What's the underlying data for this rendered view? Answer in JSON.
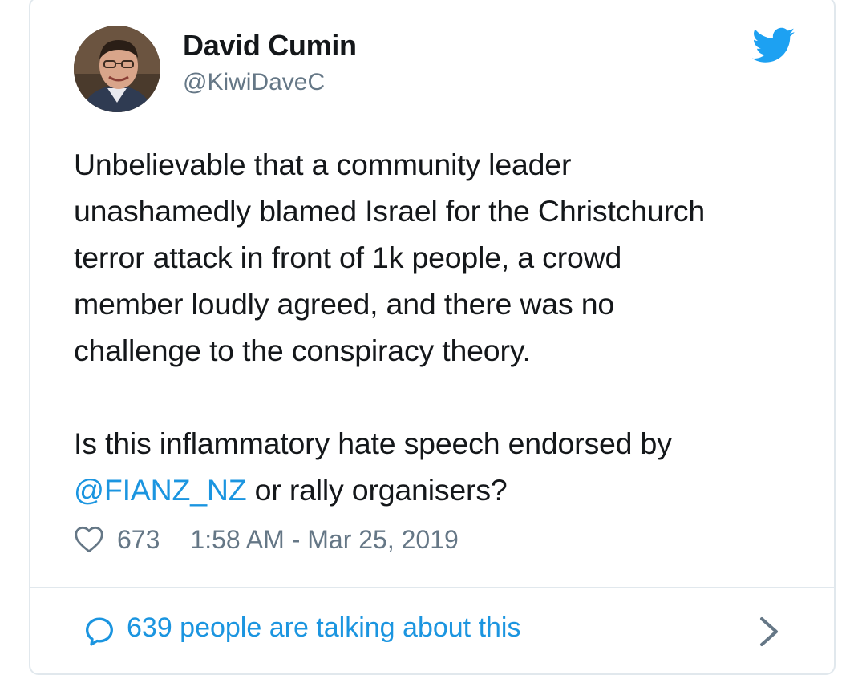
{
  "tweet": {
    "author": {
      "name": "David Cumin",
      "handle": "@KiwiDaveC",
      "avatar_icon": "profile-photo"
    },
    "brand_icon": "twitter-bird-icon",
    "brand_color": "#1da1f2",
    "text": {
      "line1": "Unbelievable that a community leader",
      "line2": "unashamedly blamed Israel for the Christchurch",
      "line3": "terror attack in front of 1k people, a crowd",
      "line4": "member loudly agreed, and there was no",
      "line5": "challenge to the conspiracy theory.",
      "line6": "Is this inflammatory hate speech endorsed by",
      "line7_mention": "@FIANZ_NZ",
      "line7_rest": " or rally organisers?"
    },
    "mention_color": "#1b95e0",
    "likes": "673",
    "timestamp": "1:58 AM - Mar 25, 2019",
    "footer": {
      "talking_label": "639 people are talking about this",
      "icons": [
        "speech-bubble-icon",
        "chevron-right-icon",
        "heart-icon"
      ]
    }
  }
}
